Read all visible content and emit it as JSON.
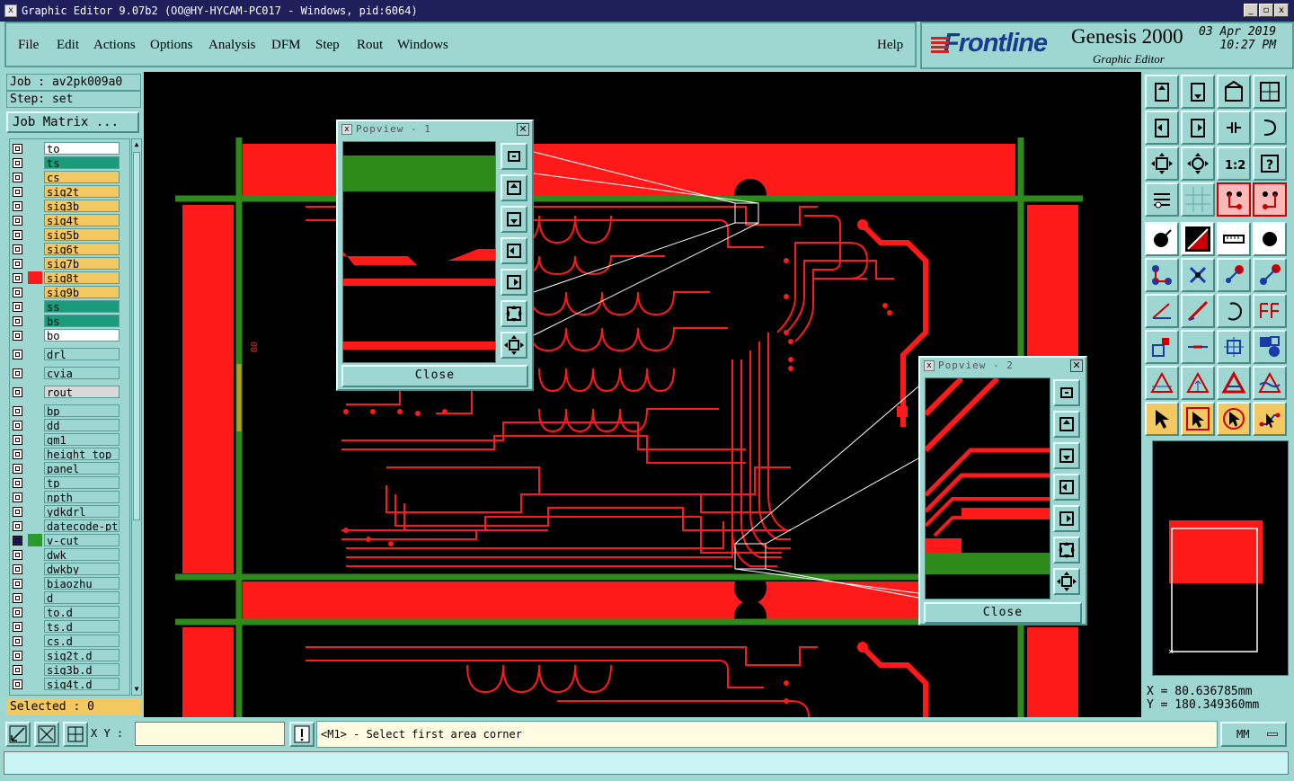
{
  "window": {
    "title": "Graphic Editor 9.07b2 (OO@HY-HYCAM-PC017 - Windows, pid:6064)",
    "controls": [
      "_",
      "▫",
      "x"
    ]
  },
  "menu": {
    "items": [
      "File",
      "Edit",
      "Actions",
      "Options",
      "Analysis",
      "DFM",
      "Step",
      "Rout",
      "Windows"
    ],
    "help": "Help"
  },
  "brand": {
    "logo": "Frontline",
    "product": "Genesis 2000",
    "subtitle": "Graphic Editor",
    "date": "03 Apr 2019",
    "time": "10:27 PM"
  },
  "job": {
    "job_label": "Job : av2pk009a0",
    "step_label": "Step: set",
    "matrix_button": "Job Matrix ..."
  },
  "layers": [
    {
      "name": "to",
      "color": "#ffffff"
    },
    {
      "name": "ts",
      "color": "#1a9c7c"
    },
    {
      "name": "cs",
      "color": "#f4c860"
    },
    {
      "name": "sig2t",
      "color": "#f4c860"
    },
    {
      "name": "sig3b",
      "color": "#f4c860"
    },
    {
      "name": "sig4t",
      "color": "#f4c860"
    },
    {
      "name": "sig5b",
      "color": "#f4c860"
    },
    {
      "name": "sig6t",
      "color": "#f4c860"
    },
    {
      "name": "sig7b",
      "color": "#f4c860"
    },
    {
      "name": "sig8t",
      "color": "#f4c860",
      "active_swatch": "#ff1a1a"
    },
    {
      "name": "sig9b",
      "color": "#f4c860"
    },
    {
      "name": "ss",
      "color": "#1a9c7c"
    },
    {
      "name": "bs",
      "color": "#1a9c7c"
    },
    {
      "name": "bo",
      "color": "#ffffff"
    },
    {
      "name": "drl",
      "color": "#9ed6d2"
    },
    {
      "name": "cvia",
      "color": "#9ed6d2"
    },
    {
      "name": "rout",
      "color": "#d8d8d8"
    },
    {
      "name": "bp",
      "color": "#9ed6d2"
    },
    {
      "name": "dd",
      "color": "#9ed6d2"
    },
    {
      "name": "gm1",
      "color": "#9ed6d2"
    },
    {
      "name": "height_top",
      "color": "#9ed6d2"
    },
    {
      "name": "panel",
      "color": "#9ed6d2"
    },
    {
      "name": "tp",
      "color": "#9ed6d2"
    },
    {
      "name": "npth",
      "color": "#9ed6d2"
    },
    {
      "name": "ydkdrl",
      "color": "#9ed6d2"
    },
    {
      "name": "datecode-pt",
      "color": "#9ed6d2"
    },
    {
      "name": "v-cut",
      "color": "#9ed6d2",
      "active_swatch": "#2a9a2a",
      "affected": true
    },
    {
      "name": "dwk",
      "color": "#9ed6d2"
    },
    {
      "name": "dwkby",
      "color": "#9ed6d2"
    },
    {
      "name": "biaozhu",
      "color": "#9ed6d2"
    },
    {
      "name": "d",
      "color": "#9ed6d2"
    },
    {
      "name": "to.d",
      "color": "#9ed6d2"
    },
    {
      "name": "ts.d",
      "color": "#9ed6d2"
    },
    {
      "name": "cs.d",
      "color": "#9ed6d2"
    },
    {
      "name": "sig2t.d",
      "color": "#9ed6d2"
    },
    {
      "name": "sig3b.d",
      "color": "#9ed6d2"
    },
    {
      "name": "sig4t.d",
      "color": "#9ed6d2"
    }
  ],
  "selected": "Selected : 0",
  "popview1": {
    "title": "Popview - 1",
    "close": "Close"
  },
  "popview2": {
    "title": "Popview - 2",
    "close": "Close"
  },
  "canvas": {
    "label": "80"
  },
  "toolbox": {
    "icons": [
      "zoom-home-icon",
      "zoom-back-icon",
      "zoom-house-icon",
      "zoom-grid-xy-icon",
      "pan-left-icon",
      "pan-right-icon",
      "fit-icon",
      "snap-icon",
      "zoom-fit-icon",
      "zoom-all-icon",
      "scale-1-2-icon",
      "help-query-icon",
      "measure-icon",
      "grid-icon",
      "net-red-icon",
      "net-red2-icon",
      "pad-black-icon",
      "shape-red-icon",
      "ruler-icon",
      "circle-black-icon",
      "connect-icon",
      "cross-icon",
      "arc-pad-icon",
      "arc-pad2-icon",
      "line-angle-icon",
      "line-diag-icon",
      "arc-icon",
      "text-ff-icon",
      "pad-square-icon",
      "line-red-icon",
      "resize-icon",
      "mosaic-icon",
      "triangle-icon",
      "triangle-arrow-icon",
      "triangle-dot-icon",
      "triangle-wave-icon",
      "pointer-icon",
      "pointer-sel-icon",
      "pointer-circle-icon",
      "pointer-net-icon"
    ]
  },
  "coordinates": {
    "x": "X = 80.636785mm",
    "y": "Y = 180.349360mm"
  },
  "status": {
    "xy_label": "X Y :",
    "xy_value": "",
    "prompt": "<M1> - Select first area corner",
    "units": "MM"
  },
  "colors": {
    "copper": "#ff1a1a",
    "vcut": "#2e8a1a",
    "panel_bg": "#9ed6d2",
    "highlight": "#f4c860"
  }
}
